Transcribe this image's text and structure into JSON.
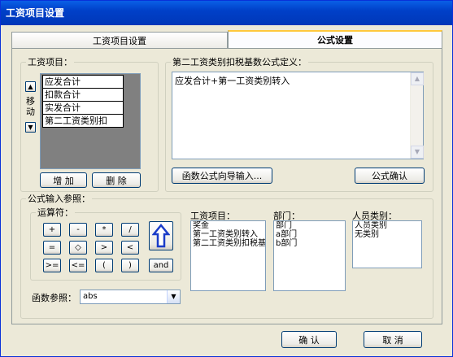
{
  "window": {
    "title": "工资项目设置"
  },
  "tabs": [
    {
      "label": "工资项目设置"
    },
    {
      "label": "公式设置"
    }
  ],
  "salary_items_group": {
    "legend": "工资项目：",
    "move_label": "移动",
    "items": [
      "应发合计",
      "扣款合计",
      "实发合计",
      "第二工资类别扣"
    ],
    "add_label": "增 加",
    "delete_label": "删 除"
  },
  "formula_group": {
    "legend": "第二工资类别扣税基数公式定义：",
    "formula_text": "应发合计+第一工资类别转入",
    "wizard_label": "函数公式向导输入...",
    "confirm_label": "公式确认"
  },
  "formula_ref": {
    "legend": "公式输入参照：",
    "operators_legend": "运算符：",
    "operators": [
      "+",
      "-",
      "*",
      "/",
      "=",
      "◇",
      ">",
      "<",
      ">=",
      "<=",
      "(",
      ")",
      "and"
    ],
    "salary_items_label": "工资项目：",
    "salary_items": [
      "奖金",
      "第一工资类别转入",
      "第二工资类别扣税基数"
    ],
    "dept_label": "部门：",
    "depts": [
      "部门",
      "a部门",
      "b部门"
    ],
    "staff_label": "人员类别：",
    "staff": [
      "人员类别",
      "无类别"
    ],
    "func_label": "函数参照：",
    "func_value": "abs"
  },
  "footer": {
    "ok_label": "确 认",
    "cancel_label": "取 消"
  }
}
